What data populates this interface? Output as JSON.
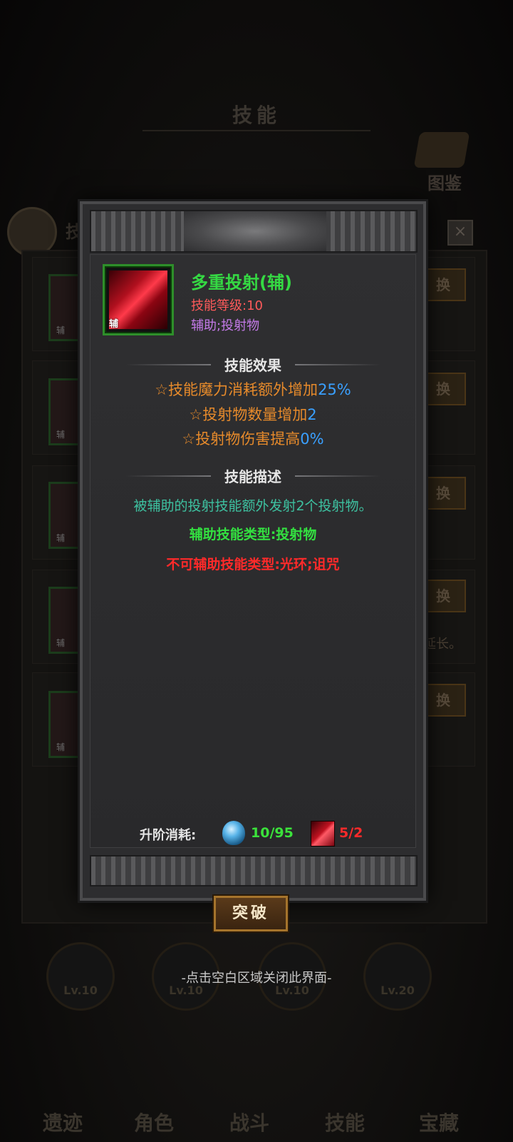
{
  "background": {
    "title": "技能",
    "atlas_label": "图鉴",
    "tab_fragment": "技",
    "swap_label": "换",
    "skill_tag": "辅",
    "extra_text": "延长。",
    "levels": [
      "Lv.10",
      "Lv.10",
      "Lv.10",
      "Lv.20"
    ],
    "nav": [
      "遗迹",
      "角色",
      "战斗",
      "技能",
      "宝藏"
    ]
  },
  "dialog": {
    "skill": {
      "name": "多重投射(辅)",
      "level": "技能等级:10",
      "tags": "辅助;投射物",
      "icon_tag": "辅"
    },
    "effects_header": "技能效果",
    "effects": [
      {
        "text": "☆技能魔力消耗额外增加",
        "value": "25%"
      },
      {
        "text": "☆投射物数量增加",
        "value": "2"
      },
      {
        "text": "☆投射物伤害提高",
        "value": "0%"
      }
    ],
    "description_header": "技能描述",
    "description": "被辅助的投射技能额外发射2个投射物。",
    "support_type": "辅助技能类型:投射物",
    "unsupported_type": "不可辅助技能类型:光环;诅咒",
    "upgrade": {
      "label": "升阶消耗:",
      "gem_amount": "10/95",
      "material_amount": "5/2"
    },
    "close_icon": "×"
  },
  "breakthrough_label": "突破",
  "close_hint": "-点击空白区域关闭此界面-",
  "colors": {
    "skill_name": "#35d943",
    "level": "#ff5a5a",
    "tags": "#c47ae8",
    "effect": "#e68a2b",
    "effect_value": "#3aa0ff",
    "description": "#3dc1a0",
    "support": "#33e040",
    "unsupported": "#ff2a2a"
  }
}
